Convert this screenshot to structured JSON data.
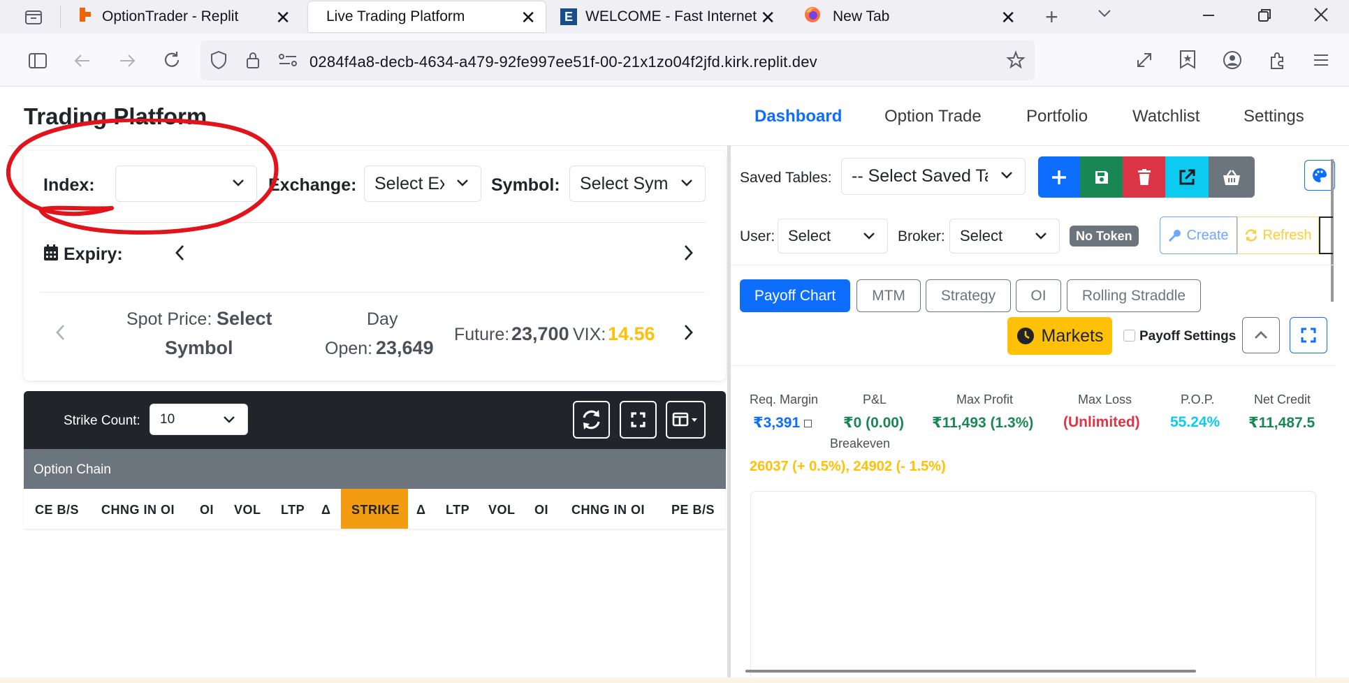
{
  "browser": {
    "tabs": [
      {
        "title": "OptionTrader - Replit"
      },
      {
        "title": "Live Trading Platform"
      },
      {
        "title": "WELCOME - Fast Internet &"
      },
      {
        "title": "New Tab"
      }
    ],
    "url": "0284f4a8-decb-4634-a479-92fe997ee51f-00-21x1zo04f2jfd.kirk.replit.dev"
  },
  "app": {
    "title": "Trading Platform",
    "nav": [
      "Dashboard",
      "Option Trade",
      "Portfolio",
      "Watchlist",
      "Settings"
    ]
  },
  "filters": {
    "index_label": "Index:",
    "index_value": "",
    "exchange_label": "Exchange:",
    "exchange_value": "Select Ex",
    "symbol_label": "Symbol:",
    "symbol_value": "Select Sym",
    "expiry_label": "Expiry:"
  },
  "market": {
    "spot_label": "Spot Price:",
    "spot_value_1": "Select",
    "spot_value_2": "Symbol",
    "day_label": "Day",
    "open_label": "Open:",
    "open_value": "23,649",
    "future_label": "Future:",
    "future_value": "23,700",
    "vix_label": "VIX:",
    "vix_value": "14.56"
  },
  "chain": {
    "strike_count_label": "Strike Count:",
    "strike_count_value": "10",
    "title": "Option Chain",
    "columns": [
      "CE B/S",
      "CHNG IN OI",
      "OI",
      "VOL",
      "LTP",
      "Δ",
      "STRIKE",
      "Δ",
      "LTP",
      "VOL",
      "OI",
      "CHNG IN OI",
      "PE B/S"
    ]
  },
  "right": {
    "saved_tables_label": "Saved Tables:",
    "saved_tables_value": "-- Select Saved Ta",
    "user_label": "User:",
    "user_value": "Select",
    "broker_label": "Broker:",
    "broker_value": "Select",
    "token_badge": "No Token",
    "create_label": "Create",
    "refresh_label": "Refresh",
    "tabs": [
      "Payoff Chart",
      "MTM",
      "Strategy",
      "OI",
      "Rolling Straddle"
    ],
    "markets_label": "Markets",
    "payoff_settings_label": "Payoff Settings"
  },
  "metrics": {
    "req_margin_label": "Req. Margin",
    "req_margin_value": "₹3,391",
    "pnl_label": "P&L",
    "pnl_value": "₹0 (0.00)",
    "max_profit_label": "Max Profit",
    "max_profit_value": "₹11,493 (1.3%)",
    "max_loss_label": "Max Loss",
    "max_loss_value": "(Unlimited)",
    "pop_label": "P.O.P.",
    "pop_value": "55.24%",
    "net_credit_label": "Net Credit",
    "net_credit_value": "₹11,487.5",
    "breakeven_label": "Breakeven",
    "breakeven_value": "26037 (+ 0.5%), 24902 (- 1.5%)"
  },
  "colors": {
    "primary": "#0d6efd",
    "success": "#198754",
    "danger": "#dc3545",
    "info": "#0dcaf0",
    "warning": "#ffc107",
    "strike": "#f39c12",
    "annotation": "#e0141a"
  }
}
